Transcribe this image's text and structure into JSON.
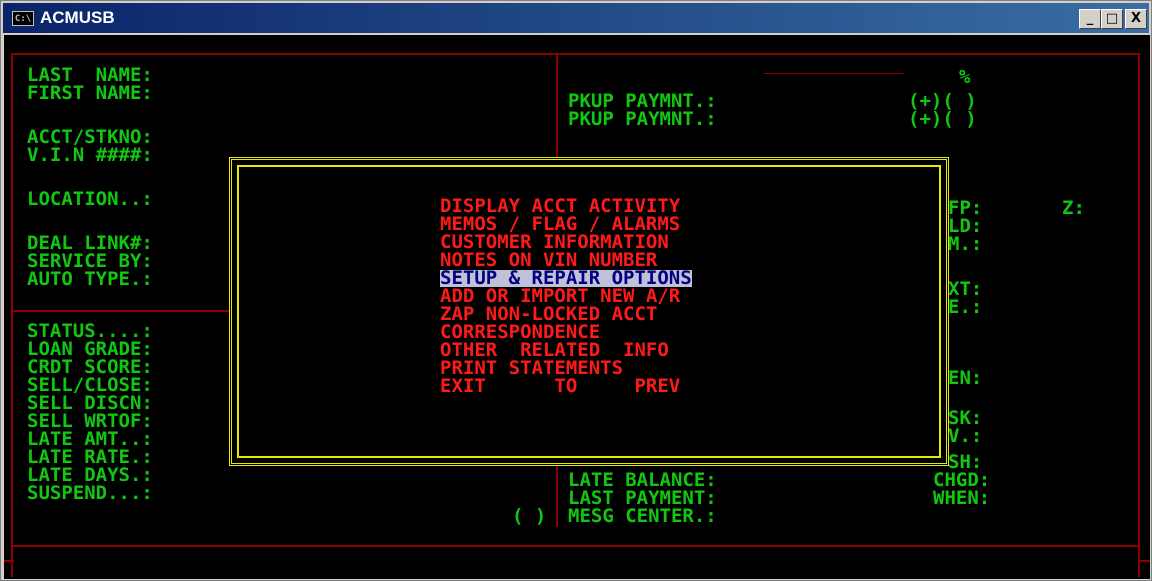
{
  "window": {
    "title": "ACMUSB",
    "icon_text": "C:\\",
    "controls": [
      "_",
      "□",
      "X"
    ]
  },
  "left_labels": [
    "LAST  NAME:",
    "FIRST NAME:",
    "",
    "ACCT/STKNO:",
    "V.I.N ####:",
    "",
    "LOCATION..:",
    "",
    "",
    "DEAL LINK#:",
    "SERVICE BY:",
    "AUTO TYPE.:",
    "",
    "",
    "STATUS....:",
    "LOAN GRADE:",
    "CRDT SCORE:",
    "SELL/CLOSE:",
    "SELL DISCN:",
    "SELL WRTOF:",
    "LATE AMT..:",
    "LATE RATE.:",
    "LATE DAYS.:",
    "SUSPEND...:"
  ],
  "right_top": {
    "percent": "%",
    "pkup1_label": "PKUP PAYMNT.:",
    "pkup1_val": "(+)( )",
    "pkup2_label": "PKUP PAYMNT.:",
    "pkup2_val": "(+)( )"
  },
  "right_partial": [
    "FP:",
    "LD:",
    "M.:",
    "XT:",
    "E.:",
    "EN:",
    "SK:",
    "V.:",
    "SH:"
  ],
  "z_label": "Z:",
  "bottom_right": {
    "late_balance": "LATE BALANCE:",
    "last_payment": "LAST PAYMENT:",
    "mesg_center": "MESG CENTER.:",
    "chgd": "CHGD:",
    "when": "WHEN:",
    "suspend_toggle": "( )"
  },
  "menu": {
    "items": [
      "DISPLAY ACCT ACTIVITY",
      "MEMOS / FLAG / ALARMS",
      "CUSTOMER INFORMATION",
      "NOTES ON VIN NUMBER",
      "SETUP & REPAIR OPTIONS",
      "ADD OR IMPORT NEW A/R",
      "ZAP NON-LOCKED ACCT",
      "CORRESPONDENCE",
      "OTHER  RELATED  INFO",
      "PRINT STATEMENTS",
      "EXIT      TO     PREV"
    ],
    "selected_index": 4
  },
  "colors": {
    "field": "#10c810",
    "menu": "#ff1a1a",
    "frame": "#8c0000",
    "border": "#e8e800",
    "selection_bg": "#c0c0d8"
  }
}
